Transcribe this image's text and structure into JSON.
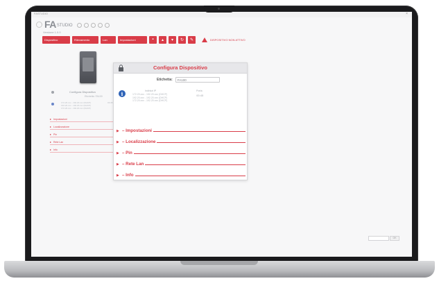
{
  "window": {
    "title": "FASTUDIO"
  },
  "app": {
    "logo_text": "FA",
    "logo_sub": "STUDIO",
    "subtitle": "Versione 1.0.0"
  },
  "toolbar": {
    "buttons": [
      "Dispositivo",
      "Rilevamento",
      "Lan",
      "Impostazioni"
    ],
    "icon_buttons": [
      "save-icon",
      "upload-icon",
      "download-icon",
      "refresh-icon",
      "settings-icon"
    ],
    "warning_text": "DISPOSITIVO NON ATTIVO"
  },
  "left_panel": {
    "device_name": "Configura Dispositivo",
    "device_sub": "Etichetta: FA100",
    "ips": [
      "172.20.xxx - 192.20.xxx (DHCP)",
      "192.20.xxx - 192.20.xxx (DHCP)",
      "172.20.xxx - 192.20.xxx (DHCP)"
    ],
    "status": "00:45",
    "items": [
      "Impostazioni",
      "Localizzazione",
      "Pin",
      "Rete Lan",
      "Info"
    ]
  },
  "dialog": {
    "title": "Configura Dispositivo",
    "label_key": "Etichetta:",
    "label_value": "FA100",
    "ip_header_left": "Indirizzi IP",
    "ip_header_right": "Porta",
    "ip_lines": [
      "172.20.xxx - 192.20.xxx (DHCP)",
      "192.20.xxx - 192.20.xxx (DHCP)",
      "172.20.xxx - 192.20.xxx (DHCP)"
    ],
    "port_value": "00:45",
    "sections": [
      {
        "arrow": "▶",
        "label": "– Impostazioni"
      },
      {
        "arrow": "▶",
        "label": "– Localizzazione"
      },
      {
        "arrow": "▶",
        "label": "– Pin"
      },
      {
        "arrow": "▶",
        "label": "– Rete Lan"
      },
      {
        "arrow": "▶",
        "label": "– Info"
      }
    ]
  },
  "footer": {
    "field_value": "",
    "button_label": "OK"
  },
  "colors": {
    "accent": "#d93c48",
    "info": "#2f63b7",
    "bezel": "#1b1b1d"
  }
}
